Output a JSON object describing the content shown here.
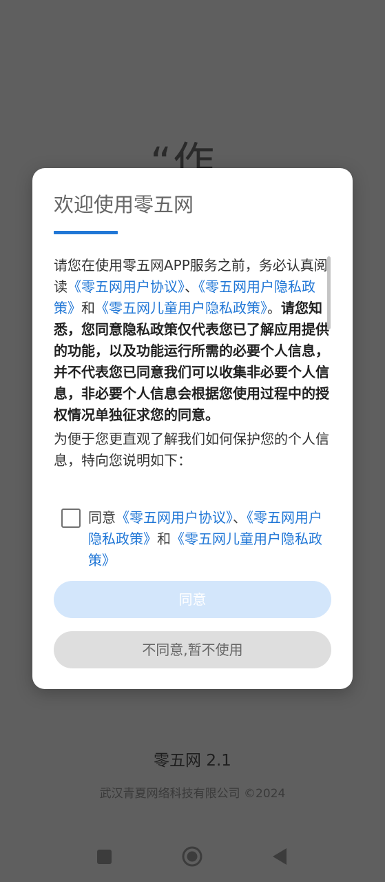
{
  "background": {
    "quote_fragment": "“作",
    "app_version": "零五网 2.1",
    "copyright": "武汉青夏网络科技有限公司 ©2024"
  },
  "dialog": {
    "title": "欢迎使用零五网",
    "p1_text_a": "请您在使用零五网APP服务之前，务必认真阅读",
    "link_user_agreement": "《零五网用户协议》",
    "sep_dun": "、",
    "link_privacy_policy": "《零五网用户隐私政策》",
    "word_and": "和",
    "link_child_privacy": "《零五网儿童用户隐私政策》",
    "p1_period": "。",
    "p1_bold": "请您知悉，您同意隐私政策仅代表您已了解应用提供的功能，以及功能运行所需的必要个人信息，并不代表您已同意我们可以收集非必要个人信息，非必要个人信息会根据您使用过程中的授权情况单独征求您的同意。",
    "p2_text": "为便于您更直观了解我们如何保护您的个人信息，特向您说明如下：",
    "agree_prefix": "同意",
    "agree_button": "同意",
    "disagree_button": "不同意,暂不使用"
  },
  "colors": {
    "accent": "#2177d6",
    "agree_button_bg": "#d3e6fb",
    "disagree_button_bg": "#dedede",
    "overlay": "#5f5f5f"
  }
}
